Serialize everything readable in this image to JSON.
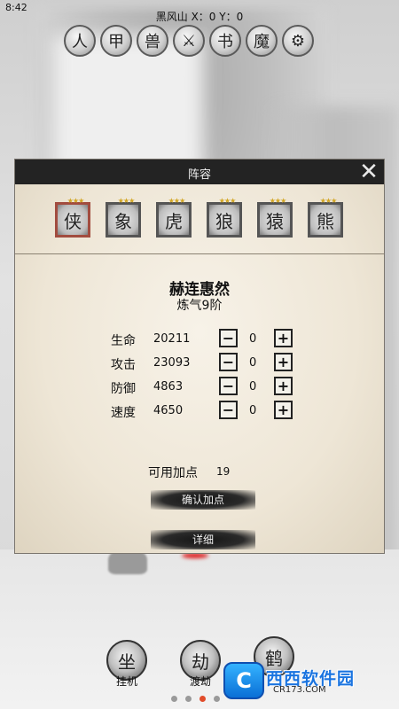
{
  "status_bar": {
    "time": "8:42"
  },
  "location": {
    "text": "黑风山 X：0 Y：0"
  },
  "top_menu": {
    "icons": [
      {
        "name": "character-icon",
        "glyph": "人"
      },
      {
        "name": "armor-icon",
        "glyph": "甲"
      },
      {
        "name": "beast-icon",
        "glyph": "兽"
      },
      {
        "name": "weapon-icon",
        "glyph": "⚔"
      },
      {
        "name": "book-icon",
        "glyph": "书"
      },
      {
        "name": "monster-icon",
        "glyph": "魔"
      },
      {
        "name": "gear-icon",
        "glyph": "⚙"
      }
    ]
  },
  "panel": {
    "title": "阵容",
    "close_glyph": "✕",
    "team": [
      {
        "name": "warrior",
        "stars": "★★★",
        "glyph": "侠",
        "selected": true
      },
      {
        "name": "elephant",
        "stars": "★★★",
        "glyph": "象",
        "selected": false
      },
      {
        "name": "tiger",
        "stars": "★★★",
        "glyph": "虎",
        "selected": false
      },
      {
        "name": "wolf",
        "stars": "★★★",
        "glyph": "狼",
        "selected": false
      },
      {
        "name": "ape",
        "stars": "★★★",
        "glyph": "猿",
        "selected": false
      },
      {
        "name": "bear",
        "stars": "★★★",
        "glyph": "熊",
        "selected": false
      }
    ],
    "hero": {
      "name": "赫连惠然",
      "rank": "炼气9阶"
    },
    "stats": [
      {
        "label": "生命",
        "value": "20211",
        "added": "0"
      },
      {
        "label": "攻击",
        "value": "23093",
        "added": "0"
      },
      {
        "label": "防御",
        "value": "4863",
        "added": "0"
      },
      {
        "label": "速度",
        "value": "4650",
        "added": "0"
      }
    ],
    "minus_glyph": "−",
    "plus_glyph": "+",
    "points_label": "可用加点",
    "points_value": "19",
    "confirm_label": "确认加点",
    "detail_label": "详细"
  },
  "bottom_nav": [
    {
      "label": "挂机",
      "glyph": "坐"
    },
    {
      "label": "渡劫",
      "glyph": "劫"
    },
    {
      "label": "",
      "glyph": "鹤"
    }
  ],
  "watermark": {
    "badge": "C",
    "text": "西西软件园",
    "url": "CR173.COM"
  }
}
